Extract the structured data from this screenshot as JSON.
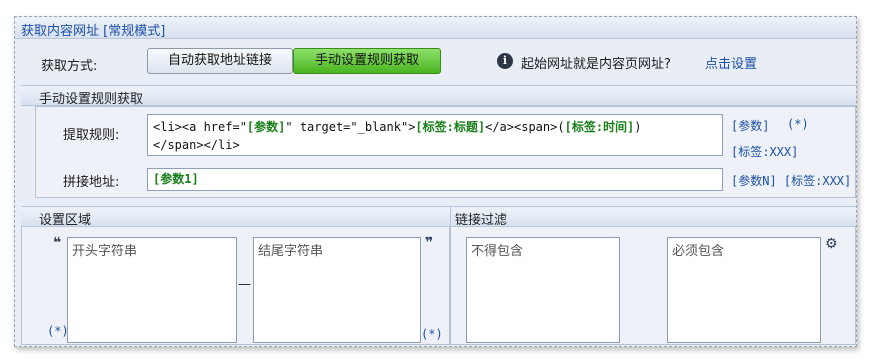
{
  "panel": {
    "title": "获取内容网址 [常规模式]"
  },
  "fetch_mode": {
    "label": "获取方式:",
    "auto_button": "自动获取地址链接",
    "manual_button": "手动设置规则获取",
    "info_text": "起始网址就是内容页网址?",
    "info_link": "点击设置"
  },
  "manual_section": {
    "title": "手动设置规则获取",
    "rule_label": "提取规则:",
    "rule_parts": {
      "p1": "<li><a href=\"",
      "t1": "[参数]",
      "p2": "\" target=\"_blank\">",
      "t2": "[标签:标题]",
      "p3": "</a><span>(",
      "t3": "[标签:时间]",
      "p4": ")",
      "line2": "</span></li>"
    },
    "rule_tokens": {
      "param": "[参数]",
      "wildcard": "(*)",
      "tag": "[标签:XXX]"
    },
    "join_label": "拼接地址:",
    "join_value": "[参数1]",
    "join_tokens": "[参数N] [标签:XXX]"
  },
  "region": {
    "title": "设置区域",
    "start_placeholder": "开头字符串",
    "end_placeholder": "结尾字符串",
    "open_quote": "❝",
    "close_quote": "❞",
    "wildcard_left": "(*)",
    "wildcard_right": "(*)",
    "dash": "—"
  },
  "filter": {
    "title": "链接过滤",
    "exclude_placeholder": "不得包含",
    "include_placeholder": "必须包含",
    "settings_icon": "⚙"
  }
}
